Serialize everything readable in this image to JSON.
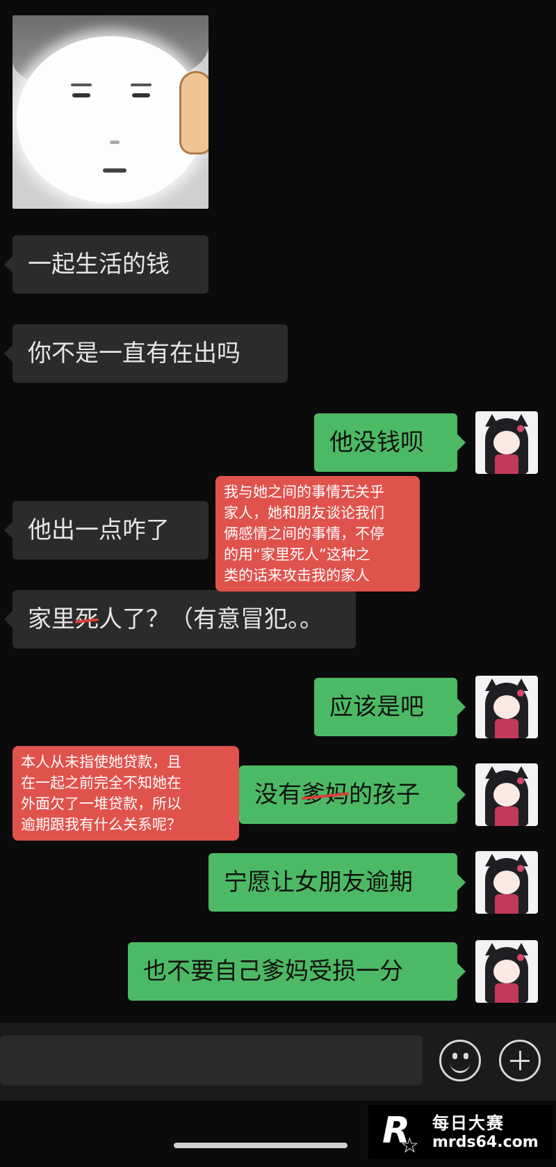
{
  "messages": [
    {
      "id": "m1",
      "side": "in",
      "text": "一起生活的钱"
    },
    {
      "id": "m2",
      "side": "in",
      "text": "你不是一直有在出吗"
    },
    {
      "id": "m3",
      "side": "out",
      "text": "他没钱呗"
    },
    {
      "id": "m4",
      "side": "in",
      "text": "他出一点咋了"
    },
    {
      "id": "m5",
      "side": "in",
      "pre": "家里",
      "struck": "死",
      "post": "人了？（有意冒犯。。"
    },
    {
      "id": "m6",
      "side": "out",
      "text": "应该是吧"
    },
    {
      "id": "m7",
      "side": "out",
      "pre": "没有",
      "struck": "爹妈",
      "post": "的孩子"
    },
    {
      "id": "m8",
      "side": "out",
      "text": "宁愿让女朋友逾期"
    },
    {
      "id": "m9",
      "side": "out",
      "text": "也不要自己爹妈受损一分"
    }
  ],
  "annotations": {
    "note1": {
      "lines": [
        "我与她之间的事情无关乎",
        "家人，她和朋友谈论我们",
        "俩感情之间的事情，不停",
        "的用“家里死人”这种之",
        "类的话来攻击我的家人"
      ]
    },
    "note2": {
      "lines": [
        "本人从未指使她贷款，且",
        "在一起之前完全不知她在",
        "外面欠了一堆贷款，所以",
        "逾期跟我有什么关系呢？"
      ]
    }
  },
  "input_bar": {
    "emoji_icon": "smiley-icon",
    "plus_icon": "plus-icon"
  },
  "watermark": {
    "logo_letter": "R",
    "logo_small": "每日大赛",
    "name": "每日大赛",
    "url": "mrds64.com"
  },
  "colors": {
    "background": "#0b0b0c",
    "incoming_bubble": "#2b2b2c",
    "outgoing_bubble": "#4cba64",
    "annotation": "#e0524c"
  }
}
